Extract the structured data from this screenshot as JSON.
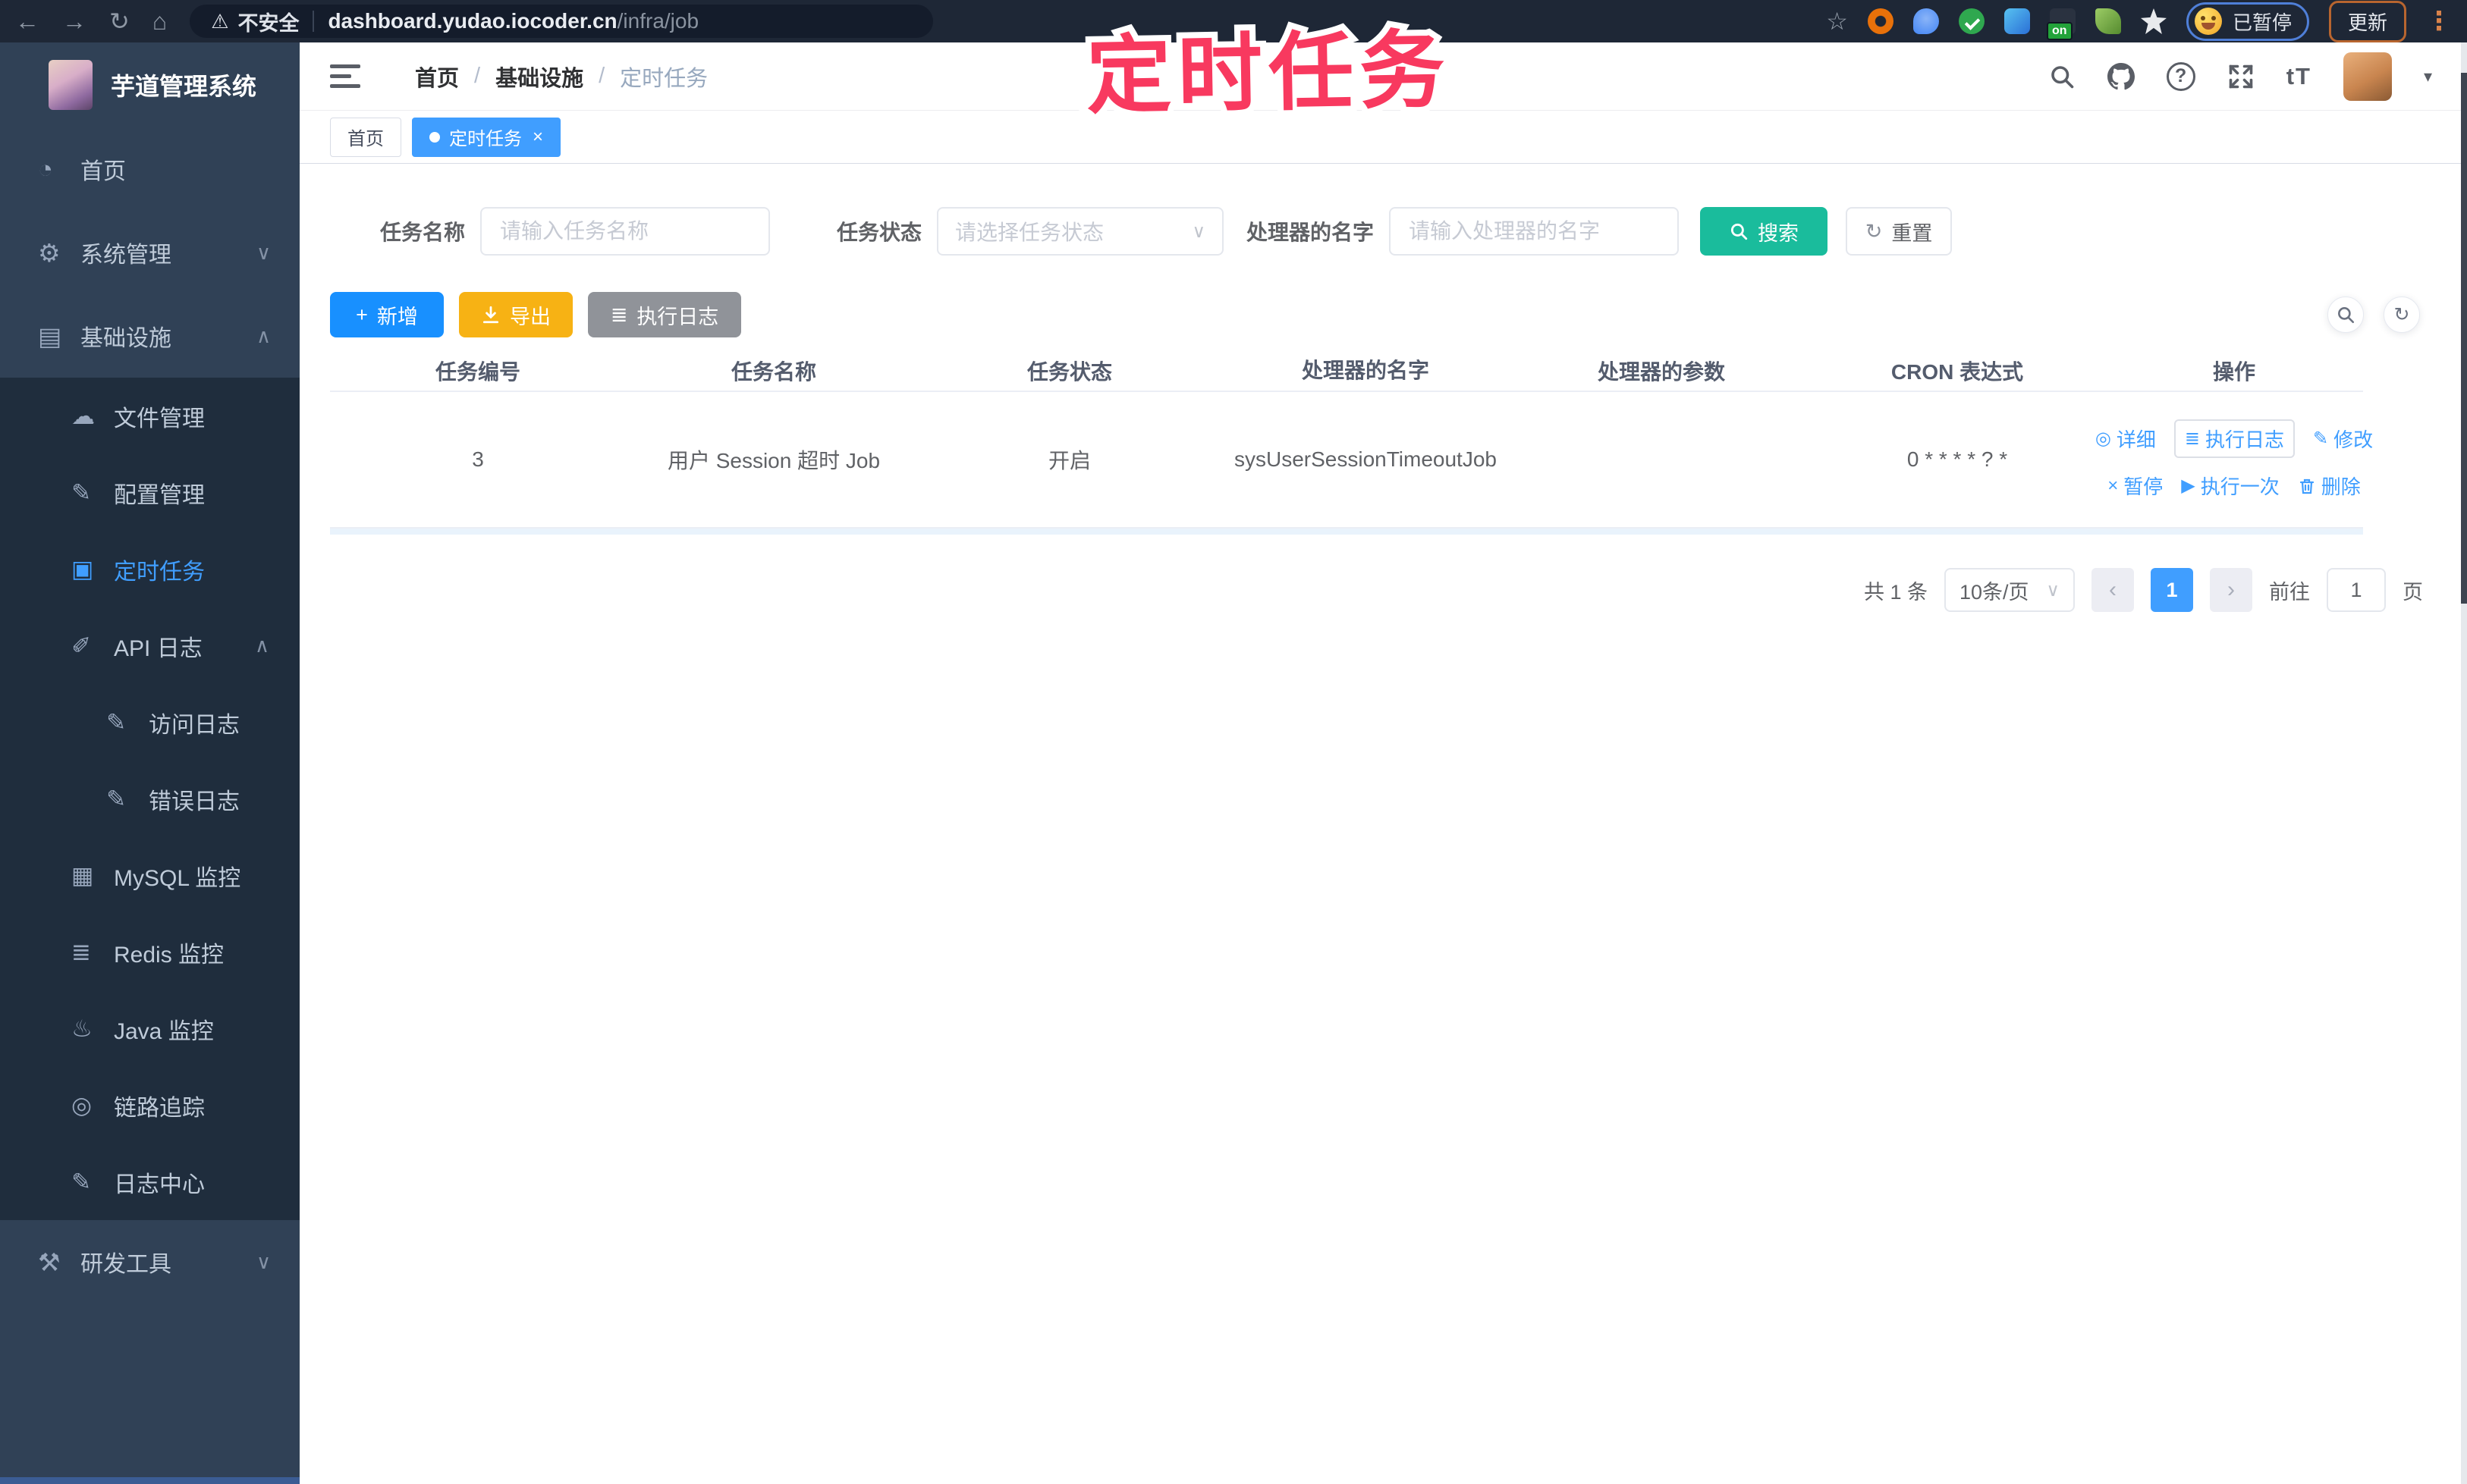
{
  "browser": {
    "security_label": "不安全",
    "url_domain": "dashboard.yudao.iocoder.cn",
    "url_path": "/infra/job",
    "ext_badge": "on",
    "paused_label": "已暂停",
    "update_label": "更新"
  },
  "annotation": {
    "text": "定时任务"
  },
  "sidebar": {
    "title": "芋道管理系统",
    "items": [
      {
        "label": "首页"
      },
      {
        "label": "系统管理"
      },
      {
        "label": "基础设施",
        "children": [
          {
            "label": "文件管理"
          },
          {
            "label": "配置管理"
          },
          {
            "label": "定时任务"
          },
          {
            "label": "API 日志",
            "children": [
              {
                "label": "访问日志"
              },
              {
                "label": "错误日志"
              }
            ]
          },
          {
            "label": "MySQL 监控"
          },
          {
            "label": "Redis 监控"
          },
          {
            "label": "Java 监控"
          },
          {
            "label": "链路追踪"
          },
          {
            "label": "日志中心"
          }
        ]
      },
      {
        "label": "研发工具"
      }
    ]
  },
  "breadcrumb": {
    "separator": "/",
    "items": [
      "首页",
      "基础设施",
      "定时任务"
    ]
  },
  "tabs": [
    {
      "label": "首页"
    },
    {
      "label": "定时任务"
    }
  ],
  "filters": {
    "name_label": "任务名称",
    "name_placeholder": "请输入任务名称",
    "status_label": "任务状态",
    "status_placeholder": "请选择任务状态",
    "handler_label": "处理器的名字",
    "handler_placeholder": "请输入处理器的名字",
    "search_label": "搜索",
    "reset_label": "重置"
  },
  "toolbar": {
    "add_label": "新增",
    "export_label": "导出",
    "log_label": "执行日志"
  },
  "table": {
    "columns": [
      "任务编号",
      "任务名称",
      "任务状态",
      "处理器的名字",
      "处理器的参数",
      "CRON 表达式",
      "操作"
    ],
    "rows": [
      {
        "id": "3",
        "name": "用户 Session 超时 Job",
        "status": "开启",
        "handler": "sysUserSessionTimeoutJob",
        "params": "",
        "cron": "0 * * * * ? *"
      }
    ],
    "actions": [
      "详细",
      "执行日志",
      "修改",
      "暂停",
      "执行一次",
      "删除"
    ]
  },
  "pagination": {
    "total": "共 1 条",
    "page_size": "10条/页",
    "page": "1",
    "goto_label": "前往",
    "goto_value": "1",
    "unit": "页"
  },
  "colors": {
    "accent": "#409eff",
    "search_button": "#1abc9c",
    "export_button": "#f7b214",
    "info_button": "#909399",
    "add_button": "#1890ff",
    "annotation": "#f8395f",
    "sidebar_bg": "#304156",
    "submenu_bg": "#1f2d3d",
    "browser_bar": "#1e2736"
  }
}
